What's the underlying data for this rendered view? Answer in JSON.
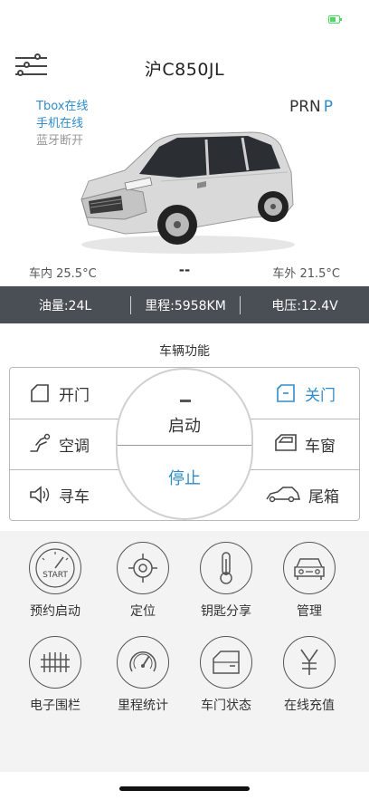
{
  "header": {
    "plate": "沪C850JL"
  },
  "status": {
    "tbox": "Tbox在线",
    "phone": "手机在线",
    "bluetooth": "蓝牙断开"
  },
  "gear": {
    "label": "PRN",
    "current": "P"
  },
  "temps": {
    "inside": "车内 25.5°C",
    "middle": "--",
    "outside": "车外 21.5°C"
  },
  "infobar": {
    "fuel": "油量:24L",
    "mileage": "里程:5958KM",
    "voltage": "电压:12.4V"
  },
  "functions": {
    "title": "车辆功能",
    "open_door": "开门",
    "close_door": "关门",
    "ac": "空调",
    "window": "车窗",
    "find_car": "寻车",
    "trunk": "尾箱",
    "start": "启动",
    "stop": "停止"
  },
  "tiles": [
    {
      "label": "预约启动",
      "icon": "start-clock-icon"
    },
    {
      "label": "定位",
      "icon": "locate-icon"
    },
    {
      "label": "钥匙分享",
      "icon": "key-icon"
    },
    {
      "label": "管理",
      "icon": "car-front-icon"
    },
    {
      "label": "电子围栏",
      "icon": "fence-icon"
    },
    {
      "label": "里程统计",
      "icon": "gauge-icon"
    },
    {
      "label": "车门状态",
      "icon": "door-icon"
    },
    {
      "label": "在线充值",
      "icon": "yen-icon"
    }
  ],
  "colors": {
    "accent": "#2f8ccb",
    "infobar": "#4a4f55",
    "battery": "#4cd964"
  }
}
